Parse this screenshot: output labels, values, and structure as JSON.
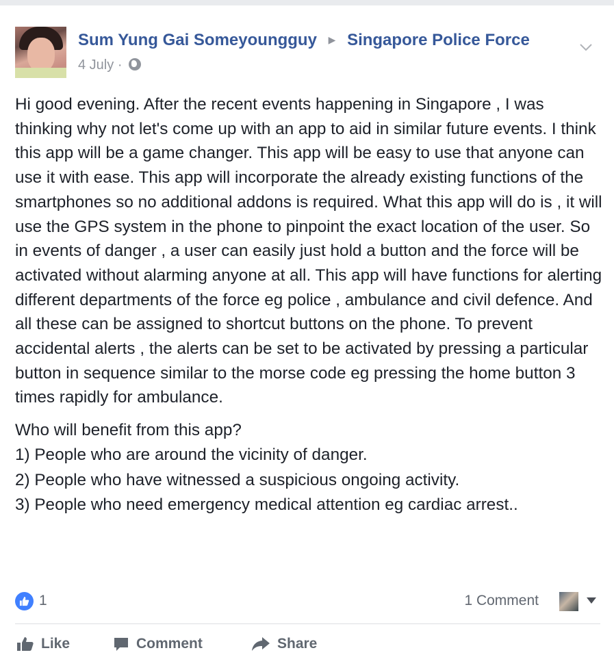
{
  "post": {
    "author": "Sum Yung Gai Someyoungguy",
    "target": "Singapore Police Force",
    "date": "4 July",
    "separator": "·",
    "paragraphs": [
      "Hi good evening. After the recent events happening in Singapore , I was thinking why not let's come up with an app to aid in similar future events. I think this app will be a game changer. This app will be easy to use that anyone can use it with ease. This app will incorporate the already existing functions of the smartphones so no additional addons is required. What this app will do is , it will use the GPS system in the phone to pinpoint the exact location of the user. So in events of danger , a user can easily just hold a button and the force will be activated without alarming anyone at all. This app will have functions for alerting different departments of the force eg police , ambulance and civil defence. And all these can be assigned to shortcut buttons on the phone. To prevent accidental alerts , the alerts can be set to be activated by pressing a particular button in sequence similar to the morse code eg pressing the home button 3 times rapidly for ambulance."
    ],
    "question": "Who will benefit from this app?",
    "points": [
      "1) People who are around the vicinity of danger.",
      "2) People who have witnessed a suspicious ongoing activity.",
      "3) People who need emergency medical attention eg cardiac arrest.."
    ]
  },
  "stats": {
    "likes": "1",
    "comments": "1 Comment"
  },
  "actions": {
    "like": "Like",
    "comment": "Comment",
    "share": "Share"
  },
  "colors": {
    "link": "#365899",
    "meta": "#90949c",
    "like_badge": "#4080ff",
    "action_text": "#606770"
  }
}
